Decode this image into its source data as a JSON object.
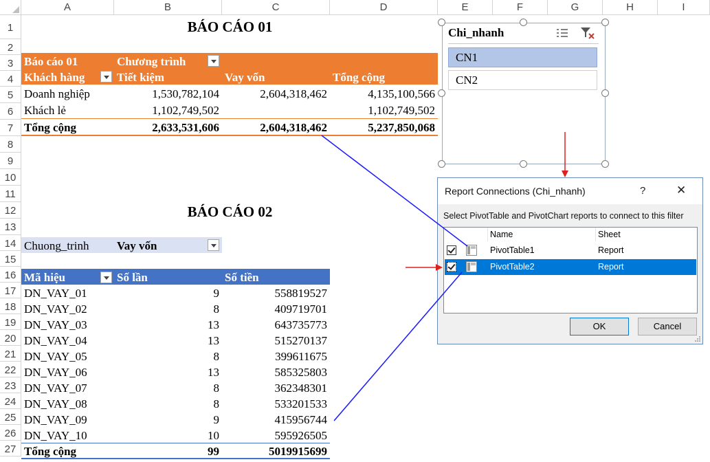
{
  "columns": [
    "A",
    "B",
    "C",
    "D",
    "E",
    "F",
    "G",
    "H",
    "I"
  ],
  "rows": [
    "1",
    "2",
    "3",
    "4",
    "5",
    "6",
    "7",
    "8",
    "9",
    "10",
    "11",
    "12",
    "13",
    "14",
    "15",
    "16",
    "17",
    "18",
    "19",
    "20",
    "21",
    "22",
    "23",
    "24",
    "25",
    "26",
    "27"
  ],
  "report1": {
    "title": "BÁO CÁO 01",
    "label": "Báo cáo 01",
    "col_field": "Chương trình",
    "row_field": "Khách hàng",
    "headers": [
      "Tiết kiệm",
      "Vay vốn",
      "Tổng cộng"
    ],
    "rows": [
      {
        "name": "Doanh nghiệp",
        "v1": "1,530,782,104",
        "v2": "2,604,318,462",
        "v3": "4,135,100,566"
      },
      {
        "name": "Khách lẻ",
        "v1": "1,102,749,502",
        "v2": "",
        "v3": "1,102,749,502"
      }
    ],
    "total": {
      "name": "Tổng cộng",
      "v1": "2,633,531,606",
      "v2": "2,604,318,462",
      "v3": "5,237,850,068"
    },
    "color": "#ED7D31"
  },
  "report2": {
    "title": "BÁO CÁO 02",
    "filter_label": "Chuong_trinh",
    "filter_value": "Vay vốn",
    "headers": [
      "Mã hiệu",
      "Số lần",
      "Số tiền"
    ],
    "rows": [
      {
        "code": "DN_VAY_01",
        "count": "9",
        "amount": "558819527"
      },
      {
        "code": "DN_VAY_02",
        "count": "8",
        "amount": "409719701"
      },
      {
        "code": "DN_VAY_03",
        "count": "13",
        "amount": "643735773"
      },
      {
        "code": "DN_VAY_04",
        "count": "13",
        "amount": "515270137"
      },
      {
        "code": "DN_VAY_05",
        "count": "8",
        "amount": "399611675"
      },
      {
        "code": "DN_VAY_06",
        "count": "13",
        "amount": "585325803"
      },
      {
        "code": "DN_VAY_07",
        "count": "8",
        "amount": "362348301"
      },
      {
        "code": "DN_VAY_08",
        "count": "8",
        "amount": "533201533"
      },
      {
        "code": "DN_VAY_09",
        "count": "9",
        "amount": "415956744"
      },
      {
        "code": "DN_VAY_10",
        "count": "10",
        "amount": "595926505"
      }
    ],
    "total": {
      "code": "Tổng cộng",
      "count": "99",
      "amount": "5019915699"
    },
    "color": "#4472C4"
  },
  "slicer": {
    "title": "Chi_nhanh",
    "items": [
      "CN1",
      "CN2"
    ],
    "selected": "CN1",
    "icons": [
      "multi-select-icon",
      "clear-filter-icon"
    ]
  },
  "dialog": {
    "title": "Report Connections (Chi_nhanh)",
    "help": "?",
    "close": "✕",
    "instruction": "Select PivotTable and PivotChart reports to connect to this filter",
    "col_name": "Name",
    "col_sheet": "Sheet",
    "items": [
      {
        "name": "PivotTable1",
        "sheet": "Report",
        "checked": true
      },
      {
        "name": "PivotTable2",
        "sheet": "Report",
        "checked": true
      }
    ],
    "ok": "OK",
    "cancel": "Cancel"
  }
}
